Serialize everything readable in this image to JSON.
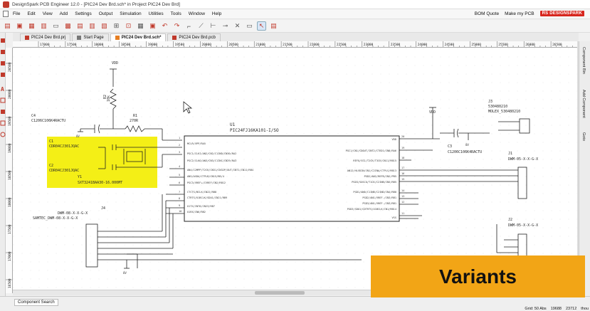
{
  "app": {
    "title": "DesignSpark PCB Engineer 12.0 - [PIC24 Dev Brd.sch* in Project PIC24 Dev Brd]"
  },
  "menu": [
    "File",
    "Edit",
    "View",
    "Add",
    "Settings",
    "Output",
    "Simulation",
    "Utilities",
    "Tools",
    "Window",
    "Help"
  ],
  "menu_right": {
    "bom_quote": "BOM Quote",
    "make_my_pcb": "Make my PCB",
    "brand": "RS DESIGNSPARK"
  },
  "tabs": [
    {
      "label": "PIC24 Dev Brd.prj",
      "active": false
    },
    {
      "label": "Start Page",
      "active": false
    },
    {
      "label": "PIC24 Dev Brd.sch*",
      "active": true
    },
    {
      "label": "PIC24 Dev Brd.pcb",
      "active": false
    }
  ],
  "ruler": {
    "top": [
      "17000",
      "17500",
      "18000",
      "18500",
      "19000",
      "19500",
      "20000",
      "20500",
      "21000",
      "21500",
      "22000",
      "22500",
      "23000",
      "23500",
      "24000",
      "24500",
      "25000",
      "25500",
      "26000",
      "26500",
      "27000"
    ],
    "left": [
      "20500",
      "20000",
      "19500",
      "19000",
      "18500",
      "18000",
      "17500",
      "17000",
      "16500"
    ]
  },
  "side_panels": [
    "Component Bin",
    "Add Component",
    "Goto"
  ],
  "schematic": {
    "ic_name": "U1",
    "ic_part": "PIC24FJ16KA101-I/SO",
    "ic_pins_left": [
      "MCLR/VPP/RA5",
      "PGC1/CLKI/AN2/CN2/C1IND/CN30/RA2",
      "PGC2/CLKO/AN3/CN3/C1INC/CN29/RA3",
      "AN4/C2MPP/T2CK/CN31/CN32P/OUT/INT1/CN11/RB4",
      "AN5/ASDA/CTPLB/CN15/RB/4",
      "PGC3/VREF+/CVREF/CN2/RB12",
      "CTCTS/BCLK/CN22/RB8",
      "CTRTS/U1BCLK/SDA1/CN21/RB9",
      "U1TX/INT0/CN23/RB7",
      "U1RX/CN6/RB2"
    ],
    "ic_pins_right": [
      "VDD",
      "PGC1/CN1/CDOUT/INT2/CTED1/CN8/RA6",
      "REFO/SS1/T2CK/T3CK/CN11/RB15",
      "AN12/HLVDIN/CN1/C2INA/CTPLS/RB13",
      "PGD2/AN2/REFB/CN2/PB5",
      "PGD3/SOSCO/T1CK/C2INB/CN5/RB5",
      "PGD1/AN0/C1INB/C2IND/CN4/RB0",
      "PGD2/AN1/VREF-/CN3/RB1",
      "PGD3/AN1/VREF-/CN3/RB1",
      "PGD3/SDO1/CDTRTS/U1BCLK/CN1/RB14",
      "VSS"
    ],
    "r1": {
      "ref": "R1",
      "value": "270R"
    },
    "r2": {
      "ref": "R2",
      "value": "10k"
    },
    "c4": {
      "ref": "C4",
      "value": "C1206C106K4RACTU"
    },
    "c1": {
      "ref": "C1",
      "value": "CDR04CJ301JQAC"
    },
    "c2": {
      "ref": "C2",
      "value": "CDR04CJ301JQAC"
    },
    "y1": {
      "ref": "Y1",
      "value": "SXT3241BAA30-16.000MT"
    },
    "c3": {
      "ref": "C3",
      "value": "C1206C106K4RACTU"
    },
    "j3": {
      "ref": "J3",
      "value": "530480210",
      "value2": "MOLEX_530480210"
    },
    "j1": {
      "ref": "J1",
      "value": "DWM-05-X-X-G-X"
    },
    "j2": {
      "ref": "J2",
      "value": "DWM-05-X-X-G-X"
    },
    "j4": {
      "ref": "J4",
      "value": "DWM-08-X-X-G-X",
      "value2": "SAMTEC_DWM-08-X-X-G-X"
    },
    "vdd": "VDD",
    "gnd": "0V",
    "pin_numbers": [
      "1",
      "2",
      "3",
      "4",
      "5",
      "6",
      "7",
      "8",
      "9",
      "10",
      "11",
      "12",
      "13",
      "14",
      "15",
      "16",
      "17",
      "18",
      "19",
      "20"
    ]
  },
  "status": {
    "component_search": "Component Search",
    "grid": "Grid: 50 Abs",
    "x": "19688",
    "y": "23712",
    "units": "thou"
  },
  "banner": "Variants"
}
